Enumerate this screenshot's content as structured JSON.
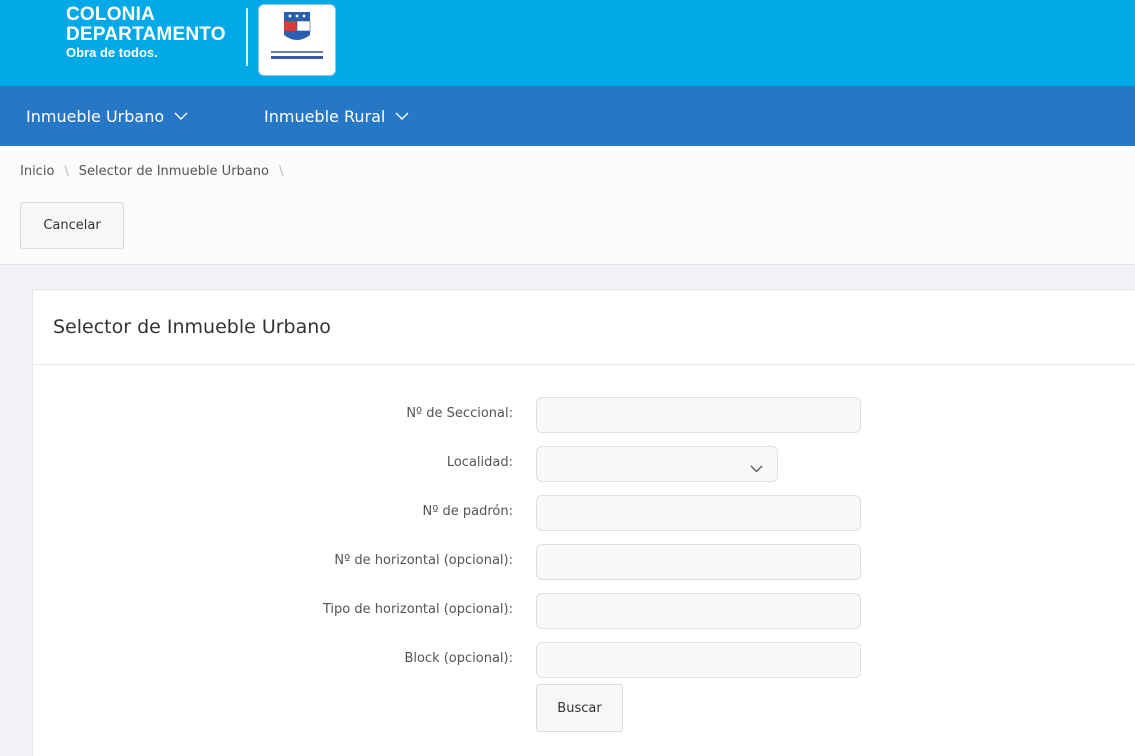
{
  "brand": {
    "line1": "COLONIA",
    "line2": "DEPARTAMENTO",
    "line3": "Obra de todos.",
    "logo_icon": "intendencia-colonia-logo"
  },
  "nav": {
    "items": [
      {
        "label": "Inmueble Urbano",
        "icon": "chevron-down-icon"
      },
      {
        "label": "Inmueble Rural",
        "icon": "chevron-down-icon"
      }
    ]
  },
  "breadcrumb": {
    "items": [
      "Inicio",
      "Selector de Inmueble Urbano"
    ],
    "separator": "\\"
  },
  "actions": {
    "cancel_label": "Cancelar"
  },
  "panel": {
    "title": "Selector de Inmueble Urbano"
  },
  "form": {
    "fields": [
      {
        "label": "Nº de Seccional:",
        "type": "text",
        "value": ""
      },
      {
        "label": "Localidad:",
        "type": "select",
        "value": ""
      },
      {
        "label": "Nº de padrón:",
        "type": "text",
        "value": ""
      },
      {
        "label": "Nº de horizontal (opcional):",
        "type": "text",
        "value": ""
      },
      {
        "label": "Tipo de horizontal (opcional):",
        "type": "text",
        "value": ""
      },
      {
        "label": "Block (opcional):",
        "type": "text",
        "value": ""
      }
    ],
    "submit_label": "Buscar"
  },
  "colors": {
    "header_bg": "#03a9e6",
    "nav_bg": "#2777c7",
    "content_bg": "#f1f3f6"
  }
}
